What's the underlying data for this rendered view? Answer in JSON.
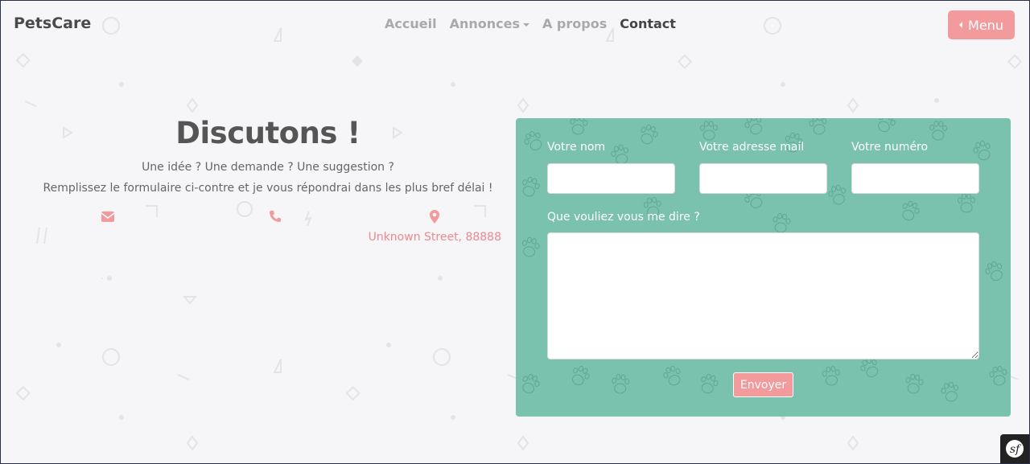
{
  "nav": {
    "brand": "PetsCare",
    "links": [
      {
        "label": "Accueil"
      },
      {
        "label": "Annonces"
      },
      {
        "label": "A propos"
      },
      {
        "label": "Contact"
      }
    ],
    "menu_label": "Menu"
  },
  "hero": {
    "title": "Discutons !",
    "line1": "Une idée ? Une demande ? Une suggestion ?",
    "line2": "Remplissez le formulaire ci-contre et je vous répondrai dans les plus bref délai !",
    "address": "Unknown Street, 88888"
  },
  "form": {
    "name_label": "Votre nom",
    "email_label": "Votre adresse mail",
    "phone_label": "Votre numéro",
    "message_label": "Que vouliez vous me dire ?",
    "submit_label": "Envoyer"
  },
  "colors": {
    "accent": "#f39a9d",
    "card": "#7ac2ae",
    "background": "#f6f6f8"
  },
  "icons": [
    "envelope-icon",
    "phone-icon",
    "map-marker-icon",
    "symfony-icon"
  ]
}
